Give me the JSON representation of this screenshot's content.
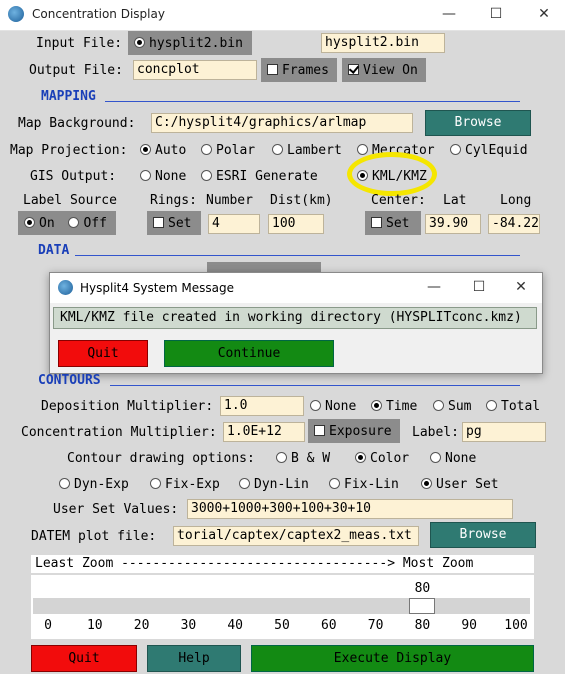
{
  "window": {
    "title": "Concentration Display",
    "minimize": "—",
    "maximize": "☐",
    "close": "✕"
  },
  "input": {
    "label": "Input File:",
    "radio_label": "hysplit2.bin",
    "value": "hysplit2.bin"
  },
  "output": {
    "label": "Output File:",
    "value": "concplot",
    "frames_label": "Frames",
    "view_label": "View On"
  },
  "mapping": {
    "section": "MAPPING",
    "background_label": "Map Background:",
    "background_value": "C:/hysplit4/graphics/arlmap",
    "browse": "Browse",
    "projection_label": "Map Projection:",
    "projections": [
      "Auto",
      "Polar",
      "Lambert",
      "Mercator",
      "CylEquid"
    ],
    "projection_selected": "Auto",
    "gis_label": "GIS Output:",
    "gis_options": [
      "None",
      "ESRI Generate",
      "KML/KMZ"
    ],
    "gis_selected": "KML/KMZ",
    "label_source_label": "Label Source",
    "label_on": "On",
    "label_off": "Off",
    "rings_label": "Rings:",
    "number_label": "Number",
    "dist_label": "Dist(km)",
    "rings_set": "Set",
    "rings_number": "4",
    "rings_dist": "100",
    "center_label": "Center:",
    "lat_label": "Lat",
    "long_label": "Long",
    "center_set": "Set",
    "lat_value": "39.90",
    "long_value": "-84.22"
  },
  "data": {
    "section": "DATA"
  },
  "dialog": {
    "title": "Hysplit4 System Message",
    "message": "KML/KMZ file created in working directory (HYSPLITconc.kmz)",
    "quit": "Quit",
    "continue": "Continue"
  },
  "contours": {
    "section": "CONTOURS",
    "deposition_label": "Deposition Multiplier:",
    "deposition_value": "1.0",
    "dep_options": [
      "None",
      "Time",
      "Sum",
      "Total"
    ],
    "dep_selected": "Time",
    "concentration_label": "Concentration Multiplier:",
    "concentration_value": "1.0E+12",
    "exposure_label": "Exposure",
    "label_label": "Label:",
    "label_value": "pg",
    "drawing_label": "Contour drawing options:",
    "drawing_options": [
      "B & W",
      "Color",
      "None"
    ],
    "drawing_selected": "Color",
    "level_options": [
      "Dyn-Exp",
      "Fix-Exp",
      "Dyn-Lin",
      "Fix-Lin",
      "User Set"
    ],
    "level_selected": "User Set",
    "user_values_label": "User Set Values:",
    "user_values": "3000+1000+300+100+30+10"
  },
  "datem": {
    "label": "DATEM plot file:",
    "value": "torial/captex/captex2_meas.txt",
    "browse": "Browse"
  },
  "zoom": {
    "caption": "Least Zoom ----------------------------------> Most Zoom",
    "value": 80,
    "value_text": "80",
    "ticks": [
      "0",
      "10",
      "20",
      "30",
      "40",
      "50",
      "60",
      "70",
      "80",
      "90",
      "100"
    ]
  },
  "footer": {
    "quit": "Quit",
    "help": "Help",
    "execute": "Execute Display"
  },
  "colors": {
    "highlight_circle": "#f5e600",
    "section_blue": "#1a3fb8",
    "quit_red": "#f20c0c",
    "execute_green": "#138a13",
    "browse_teal": "#2f7a72"
  }
}
